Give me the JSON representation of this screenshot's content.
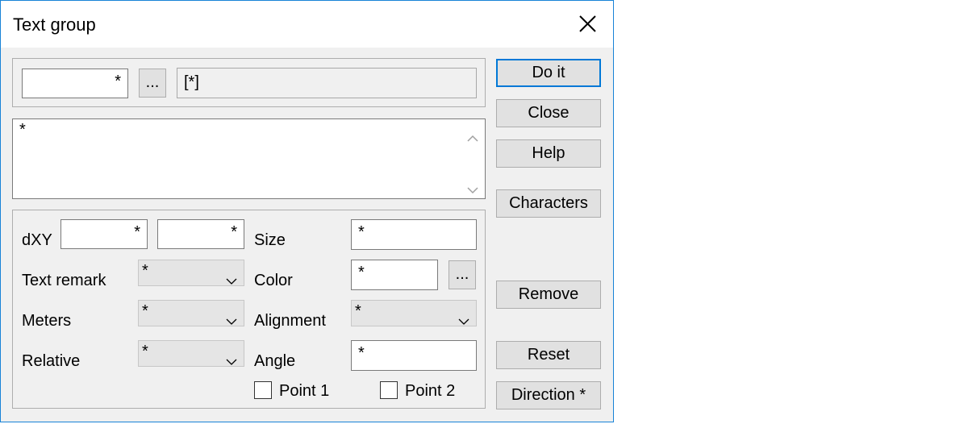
{
  "window": {
    "title": "Text group"
  },
  "top_group": {
    "code_value": "*",
    "browse_label": "...",
    "name_value": "[*]"
  },
  "text_area": {
    "value": "*"
  },
  "params": {
    "dxy_label": "dXY",
    "dx_value": "*",
    "dy_value": "*",
    "text_remark_label": "Text remark",
    "text_remark_value": "*",
    "meters_label": "Meters",
    "meters_value": "*",
    "relative_label": "Relative",
    "relative_value": "*",
    "size_label": "Size",
    "size_value": "*",
    "color_label": "Color",
    "color_value": "*",
    "color_browse_label": "...",
    "alignment_label": "Alignment",
    "alignment_value": "*",
    "angle_label": "Angle",
    "angle_value": "*",
    "point1_label": "Point 1",
    "point2_label": "Point 2"
  },
  "buttons": {
    "do_it": "Do it",
    "close": "Close",
    "help": "Help",
    "characters": "Characters",
    "remove": "Remove",
    "reset": "Reset",
    "direction": "Direction *"
  },
  "icons": {
    "close": "close-icon",
    "scroll_up": "scroll-up-icon",
    "scroll_down": "scroll-down-icon",
    "chevron": "chevron-down-icon"
  }
}
